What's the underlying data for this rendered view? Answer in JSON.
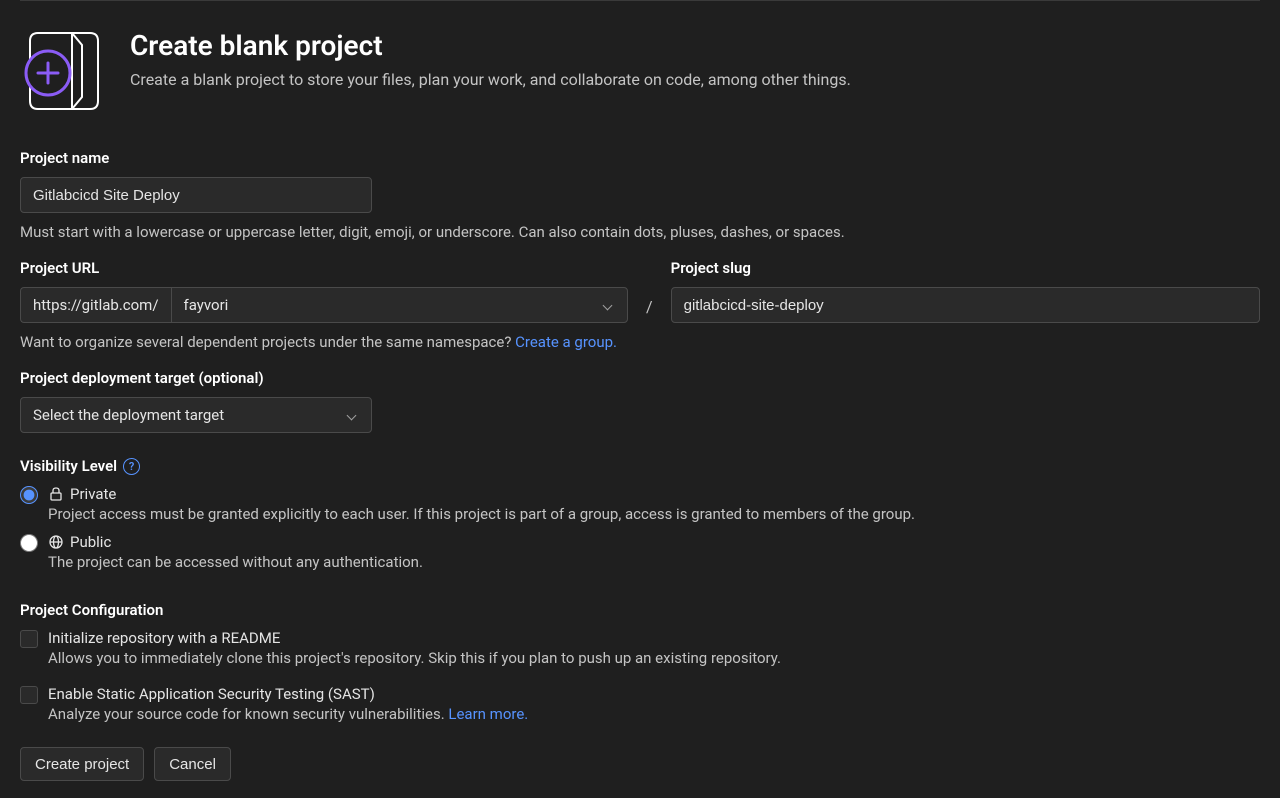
{
  "header": {
    "title": "Create blank project",
    "subtitle": "Create a blank project to store your files, plan your work, and collaborate on code, among other things."
  },
  "project_name": {
    "label": "Project name",
    "value": "Gitlabcicd Site Deploy",
    "help": "Must start with a lowercase or uppercase letter, digit, emoji, or underscore. Can also contain dots, pluses, dashes, or spaces."
  },
  "project_url": {
    "label": "Project URL",
    "prefix": "https://gitlab.com/",
    "namespace": "fayvori",
    "slash": "/"
  },
  "project_slug": {
    "label": "Project slug",
    "value": "gitlabcicd-site-deploy"
  },
  "group_hint": {
    "text": "Want to organize several dependent projects under the same namespace? ",
    "link": "Create a group."
  },
  "deployment_target": {
    "label": "Project deployment target (optional)",
    "placeholder": "Select the deployment target"
  },
  "visibility": {
    "label": "Visibility Level",
    "private": {
      "title": "Private",
      "desc": "Project access must be granted explicitly to each user. If this project is part of a group, access is granted to members of the group."
    },
    "public": {
      "title": "Public",
      "desc": "The project can be accessed without any authentication."
    }
  },
  "config": {
    "label": "Project Configuration",
    "readme": {
      "title": "Initialize repository with a README",
      "desc": "Allows you to immediately clone this project's repository. Skip this if you plan to push up an existing repository."
    },
    "sast": {
      "title": "Enable Static Application Security Testing (SAST)",
      "desc": "Analyze your source code for known security vulnerabilities. ",
      "link": "Learn more."
    }
  },
  "buttons": {
    "create": "Create project",
    "cancel": "Cancel"
  }
}
